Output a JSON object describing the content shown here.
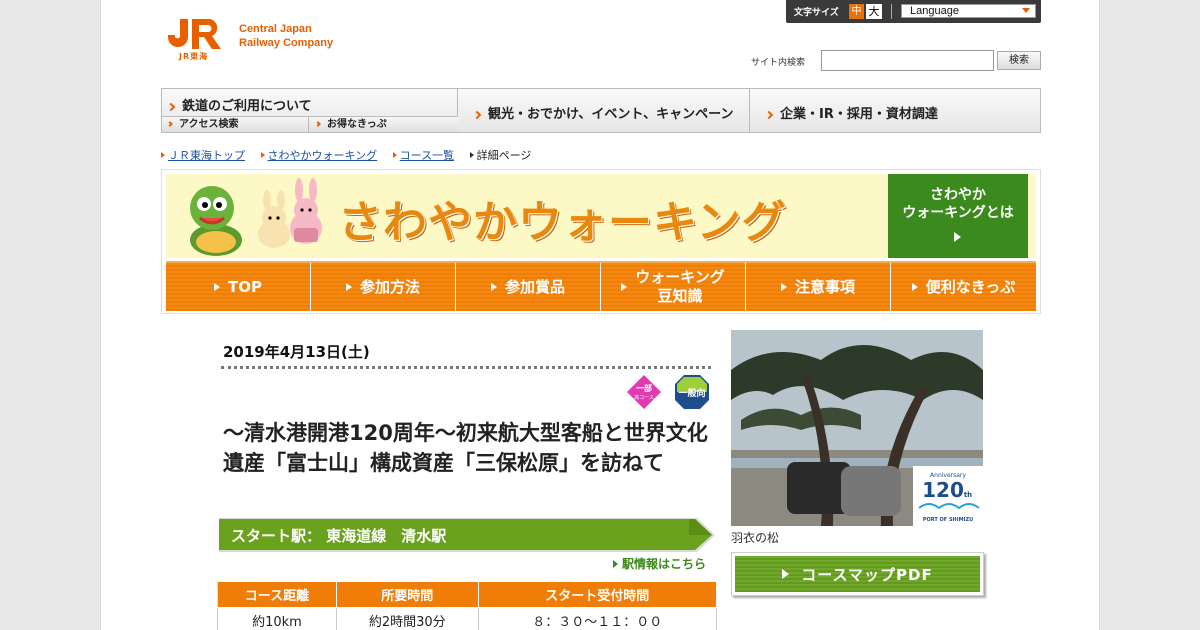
{
  "header": {
    "logo_mark": "JR",
    "logo_sub": "JR東海",
    "logo_line1": "Central Japan",
    "logo_line2": "Railway Company",
    "font_size_label": "文字サイズ",
    "font_size_mid": "中",
    "font_size_large": "大",
    "language_label": "Language",
    "search_label": "サイト内検索",
    "search_value": "",
    "search_button": "検索"
  },
  "nav": {
    "items": [
      {
        "label": "鉄道のご利用について"
      },
      {
        "label": "観光・おでかけ、イベント、キャンペーン"
      },
      {
        "label": "企業・IR・採用・資材調達"
      }
    ],
    "sub_items": [
      {
        "label": "アクセス検索"
      },
      {
        "label": "お得なきっぷ"
      }
    ]
  },
  "breadcrumb": {
    "items": [
      {
        "label": "ＪＲ東海トップ"
      },
      {
        "label": "さわやかウォーキング"
      },
      {
        "label": "コース一覧"
      },
      {
        "label": "詳細ページ"
      }
    ]
  },
  "banner": {
    "title": "さわやかウォーキング",
    "about_line1": "さわやか",
    "about_line2": "ウォーキングとは",
    "tabs": [
      {
        "label": "TOP"
      },
      {
        "label": "参加方法"
      },
      {
        "label": "参加賞品"
      },
      {
        "label_line1": "ウォーキング",
        "label_line2": "豆知識"
      },
      {
        "label": "注意事項"
      },
      {
        "label": "便利なきっぷ"
      }
    ]
  },
  "course": {
    "date": "2019年4月13日(土)",
    "badge1_top": "一部",
    "badge1_bottom": "高コース",
    "badge2": "一般向",
    "title": "～清水港開港120周年～初来航大型客船と世界文化遺産「富士山」構成資産「三保松原」を訪ねて",
    "start_station": "スタート駅：  東海道線　清水駅",
    "station_link": "駅情報はこちら",
    "table": {
      "headers": [
        "コース距離",
        "所要時間",
        "スタート受付時間"
      ],
      "values": [
        "約10km",
        "約2時間30分",
        "８：３０～１１：００"
      ]
    }
  },
  "sidebar": {
    "photo_badge_top": "Anniversary",
    "photo_badge_num": "120",
    "photo_badge_unit": "th",
    "photo_badge_bottom": "PORT OF SHIMIZU",
    "photo_caption": "羽衣の松",
    "pdf_button": "コースマップPDF"
  },
  "colors": {
    "brand_orange": "#e85f00",
    "tab_orange": "#ef7d08",
    "green": "#3a8a1d",
    "link_blue": "#1a4fa0"
  }
}
